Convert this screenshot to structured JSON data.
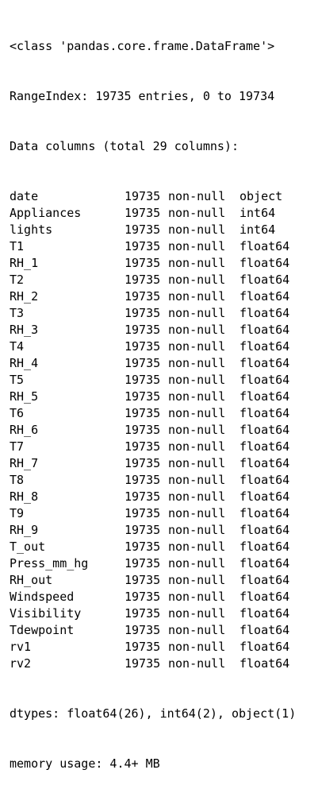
{
  "header": {
    "class_line": "<class 'pandas.core.frame.DataFrame'>",
    "range_index": "RangeIndex: 19735 entries, 0 to 19734",
    "columns_summary": "Data columns (total 29 columns):"
  },
  "columns": [
    {
      "name": "date",
      "count": "19735",
      "nullness": "non-null",
      "dtype": "object"
    },
    {
      "name": "Appliances",
      "count": "19735",
      "nullness": "non-null",
      "dtype": "int64"
    },
    {
      "name": "lights",
      "count": "19735",
      "nullness": "non-null",
      "dtype": "int64"
    },
    {
      "name": "T1",
      "count": "19735",
      "nullness": "non-null",
      "dtype": "float64"
    },
    {
      "name": "RH_1",
      "count": "19735",
      "nullness": "non-null",
      "dtype": "float64"
    },
    {
      "name": "T2",
      "count": "19735",
      "nullness": "non-null",
      "dtype": "float64"
    },
    {
      "name": "RH_2",
      "count": "19735",
      "nullness": "non-null",
      "dtype": "float64"
    },
    {
      "name": "T3",
      "count": "19735",
      "nullness": "non-null",
      "dtype": "float64"
    },
    {
      "name": "RH_3",
      "count": "19735",
      "nullness": "non-null",
      "dtype": "float64"
    },
    {
      "name": "T4",
      "count": "19735",
      "nullness": "non-null",
      "dtype": "float64"
    },
    {
      "name": "RH_4",
      "count": "19735",
      "nullness": "non-null",
      "dtype": "float64"
    },
    {
      "name": "T5",
      "count": "19735",
      "nullness": "non-null",
      "dtype": "float64"
    },
    {
      "name": "RH_5",
      "count": "19735",
      "nullness": "non-null",
      "dtype": "float64"
    },
    {
      "name": "T6",
      "count": "19735",
      "nullness": "non-null",
      "dtype": "float64"
    },
    {
      "name": "RH_6",
      "count": "19735",
      "nullness": "non-null",
      "dtype": "float64"
    },
    {
      "name": "T7",
      "count": "19735",
      "nullness": "non-null",
      "dtype": "float64"
    },
    {
      "name": "RH_7",
      "count": "19735",
      "nullness": "non-null",
      "dtype": "float64"
    },
    {
      "name": "T8",
      "count": "19735",
      "nullness": "non-null",
      "dtype": "float64"
    },
    {
      "name": "RH_8",
      "count": "19735",
      "nullness": "non-null",
      "dtype": "float64"
    },
    {
      "name": "T9",
      "count": "19735",
      "nullness": "non-null",
      "dtype": "float64"
    },
    {
      "name": "RH_9",
      "count": "19735",
      "nullness": "non-null",
      "dtype": "float64"
    },
    {
      "name": "T_out",
      "count": "19735",
      "nullness": "non-null",
      "dtype": "float64"
    },
    {
      "name": "Press_mm_hg",
      "count": "19735",
      "nullness": "non-null",
      "dtype": "float64"
    },
    {
      "name": "RH_out",
      "count": "19735",
      "nullness": "non-null",
      "dtype": "float64"
    },
    {
      "name": "Windspeed",
      "count": "19735",
      "nullness": "non-null",
      "dtype": "float64"
    },
    {
      "name": "Visibility",
      "count": "19735",
      "nullness": "non-null",
      "dtype": "float64"
    },
    {
      "name": "Tdewpoint",
      "count": "19735",
      "nullness": "non-null",
      "dtype": "float64"
    },
    {
      "name": "rv1",
      "count": "19735",
      "nullness": "non-null",
      "dtype": "float64"
    },
    {
      "name": "rv2",
      "count": "19735",
      "nullness": "non-null",
      "dtype": "float64"
    }
  ],
  "footer": {
    "dtypes": "dtypes: float64(26), int64(2), object(1)",
    "memory": "memory usage: 4.4+ MB"
  }
}
